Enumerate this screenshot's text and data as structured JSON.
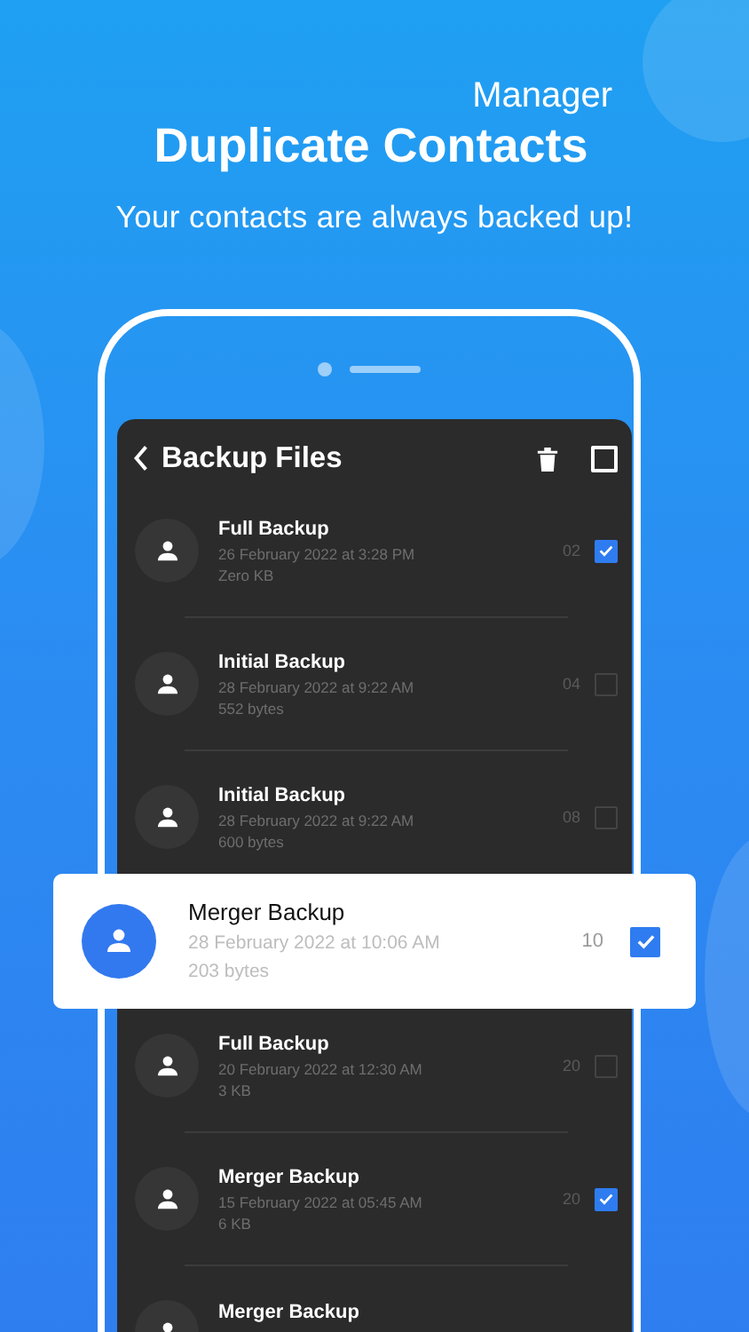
{
  "header": {
    "subtitle_small": "Manager",
    "title": "Duplicate Contacts",
    "tagline": "Your contacts are always backed up!"
  },
  "screen": {
    "title": "Backup Files",
    "select_all": {
      "checked": false
    }
  },
  "backups": [
    {
      "kind": "normal",
      "name": "Full Backup",
      "date": "26 February 2022 at 3:28 PM",
      "size": "Zero KB",
      "count": "02",
      "checked": true
    },
    {
      "kind": "normal",
      "name": "Initial Backup",
      "date": "28 February 2022 at 9:22 AM",
      "size": "552 bytes",
      "count": "04",
      "checked": false
    },
    {
      "kind": "normal",
      "name": "Initial Backup",
      "date": "28 February 2022 at 9:22 AM",
      "size": "600 bytes",
      "count": "08",
      "checked": false
    },
    {
      "kind": "highlighted",
      "name": "Merger Backup",
      "date": "28 February 2022 at 10:06 AM",
      "size": "203 bytes",
      "count": "10",
      "checked": true
    },
    {
      "kind": "normal",
      "name": "Full Backup",
      "date": "20 February 2022 at 12:30 AM",
      "size": "3 KB",
      "count": "20",
      "checked": false
    },
    {
      "kind": "normal",
      "name": "Merger Backup",
      "date": "15 February 2022 at 05:45 AM",
      "size": "6 KB",
      "count": "20",
      "checked": true
    },
    {
      "kind": "cut",
      "name": "Merger Backup"
    }
  ]
}
